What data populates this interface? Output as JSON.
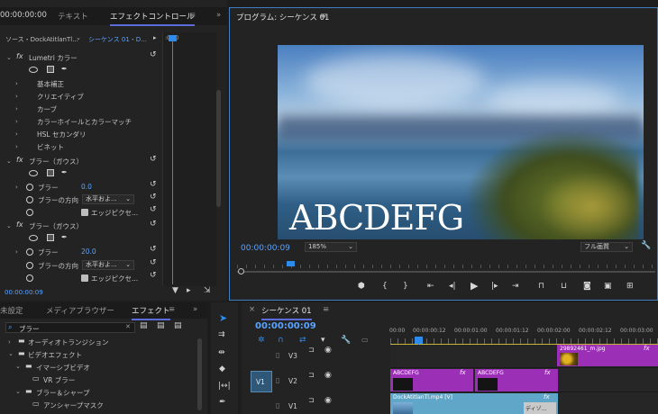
{
  "effect_controls": {
    "timecode_top": "00:00:00:00",
    "tabs": [
      "テキスト",
      "エフェクトコントロール"
    ],
    "source_label": "ソース・DockAtitlanTl...",
    "sequence_label": "シーケンス 01・D...",
    "ruler_start": ":00:0",
    "lumetri": {
      "name": "Lumetri カラー",
      "items": [
        "基本補正",
        "クリエイティブ",
        "カーブ",
        "カラーホイールとカラーマッチ",
        "HSL セカンダリ",
        "ビネット"
      ]
    },
    "blur1": {
      "name": "ブラー（ガウス）",
      "blur_label": "ブラー",
      "blur_value": "0.0",
      "dir_label": "ブラーの方向",
      "dir_value": "水平およ...",
      "edge_label": "エッジピクセ..."
    },
    "blur2": {
      "name": "ブラー（ガウス）",
      "blur_label": "ブラー",
      "blur_value": "20.0",
      "dir_label": "ブラーの方向",
      "dir_value": "水平およ...",
      "edge_label": "エッジピクセ..."
    },
    "timecode_bottom": "00:00:00:09"
  },
  "program": {
    "title": "プログラム: シーケンス 01",
    "overlay_text": "ABCDEFG",
    "timecode": "00:00:00:09",
    "zoom": "185%",
    "quality": "フル画質"
  },
  "effects_panel": {
    "tabs": [
      "未設定",
      "メディアブラウザー",
      "エフェクト"
    ],
    "search_value": "ブラー",
    "tree": [
      "オーディオトランジション",
      "ビデオエフェクト",
      "イマーシブビデオ",
      "VR ブラー",
      "ブラー＆シャープ",
      "アンシャープマスク"
    ]
  },
  "timeline": {
    "title": "シーケンス 01",
    "timecode": "00:00:00:09",
    "ruler": [
      "00:00",
      "00:00:00:12",
      "00:00:01:00",
      "00:00:01:12",
      "00:00:02:00",
      "00:00:02:12",
      "00:00:03:00"
    ],
    "tracks": [
      "V3",
      "V2",
      "V1"
    ],
    "target_label": "V1",
    "clips": {
      "v3": "29892461_m.jpg",
      "v2a": "ABCDEFG",
      "v2b": "ABCDEFG",
      "v1": "DockAtitlanTl.mp4 [V]",
      "v1_thumb_text": "ディゾ..."
    },
    "fx_badge": "fx"
  },
  "colors": {
    "accent_blue": "#2d8ceb",
    "clip_purple": "#9b2fb5",
    "clip_teal": "#5fa6c9",
    "focus_border": "#3f7fbf"
  }
}
